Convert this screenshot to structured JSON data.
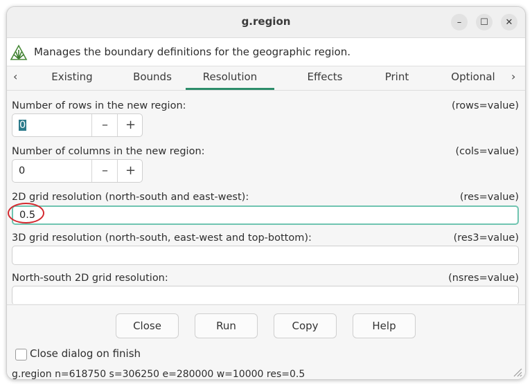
{
  "window": {
    "title": "g.region"
  },
  "window_controls": {
    "minimize": "–",
    "maximize": "☐",
    "close": "✕"
  },
  "description": "Manages the boundary definitions for the geographic region.",
  "tabs": [
    {
      "label": "Existing",
      "active": false
    },
    {
      "label": "Bounds",
      "active": false
    },
    {
      "label": "Resolution",
      "active": true
    },
    {
      "label": "Effects",
      "active": false
    },
    {
      "label": "Print",
      "active": false
    },
    {
      "label": "Optional",
      "active": false
    }
  ],
  "tab_nav": {
    "prev": "‹",
    "next": "›"
  },
  "fields": {
    "rows": {
      "label": "Number of rows in the new region:",
      "hint": "(rows=value)",
      "value": "0"
    },
    "cols": {
      "label": "Number of columns in the new region:",
      "hint": "(cols=value)",
      "value": "0"
    },
    "res": {
      "label": "2D grid resolution (north-south and east-west):",
      "hint": "(res=value)",
      "value": "0.5"
    },
    "res3": {
      "label": "3D grid resolution (north-south, east-west and top-bottom):",
      "hint": "(res3=value)",
      "value": ""
    },
    "nsres": {
      "label": "North-south 2D grid resolution:",
      "hint": "(nsres=value)",
      "value": ""
    }
  },
  "spin_symbols": {
    "minus": "–",
    "plus": "+"
  },
  "buttons": {
    "close": "Close",
    "run": "Run",
    "copy": "Copy",
    "help": "Help"
  },
  "close_on_finish": {
    "label": "Close dialog on finish",
    "checked": false
  },
  "status": "g.region n=618750 s=306250 e=280000 w=10000 res=0.5",
  "colors": {
    "accent": "#2c8d6a",
    "focus_border": "#6fc4b0",
    "annotation": "#d4292f"
  }
}
